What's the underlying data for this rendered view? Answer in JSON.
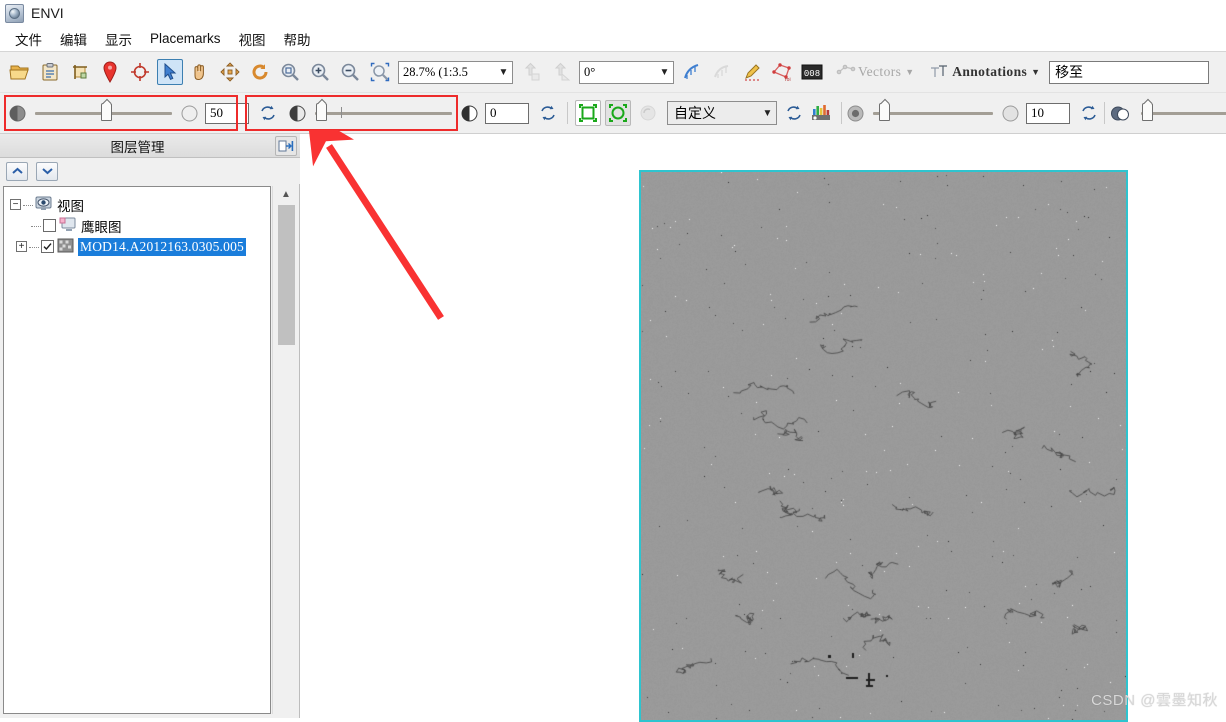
{
  "window": {
    "title": "ENVI",
    "icon": "envi-globe-icon"
  },
  "menubar": {
    "items": [
      {
        "label": "文件",
        "name": "menu-file"
      },
      {
        "label": "编辑",
        "name": "menu-edit"
      },
      {
        "label": "显示",
        "name": "menu-display"
      },
      {
        "label": "Placemarks",
        "name": "menu-placemarks"
      },
      {
        "label": "视图",
        "name": "menu-view"
      },
      {
        "label": "帮助",
        "name": "menu-help"
      }
    ]
  },
  "toolbar1": {
    "buttons": [
      {
        "name": "open-file-icon",
        "title": "打开"
      },
      {
        "name": "clipboard-icon",
        "title": "剪贴板"
      },
      {
        "name": "crop-icon",
        "title": "裁剪"
      },
      {
        "name": "placemark-pin-icon",
        "title": "标记"
      },
      {
        "name": "crosshair-icon",
        "title": "十字光标"
      },
      {
        "name": "select-cursor-icon",
        "title": "选择",
        "selected": true
      },
      {
        "name": "pan-hand-icon",
        "title": "平移"
      },
      {
        "name": "move-arrows-icon",
        "title": "移动"
      },
      {
        "name": "rotate-icon",
        "title": "旋转"
      },
      {
        "name": "zoom-fit-icon",
        "title": "缩放至窗口"
      },
      {
        "name": "zoom-in-icon",
        "title": "放大"
      },
      {
        "name": "zoom-out-icon",
        "title": "缩小"
      },
      {
        "name": "zoom-select-icon",
        "title": "区域缩放"
      }
    ],
    "zoom_combo": {
      "value": "28.7% (1:3.5",
      "name": "zoom-level-combo"
    },
    "up_layer": {
      "name": "go-up-layer-icon"
    },
    "up_layer2": {
      "name": "go-up-layer-alt-icon"
    },
    "rotation_combo": {
      "value": "0°",
      "name": "rotation-combo"
    },
    "after_buttons": [
      {
        "name": "measure-icon"
      },
      {
        "name": "measure-alt-icon",
        "disabled": true
      },
      {
        "name": "roi-pencil-icon"
      },
      {
        "name": "roi-tool-icon"
      },
      {
        "name": "pixel-value-icon"
      }
    ],
    "vectors": {
      "label": "Vectors",
      "name": "vectors-menu",
      "disabled": true
    },
    "annotations": {
      "label": "Annotations",
      "name": "annotations-menu"
    },
    "goto": {
      "value": "移至",
      "name": "goto-input"
    }
  },
  "toolbar2": {
    "transparency": {
      "value": "50",
      "name": "transparency-slider",
      "left_icon": "opacity-full-icon",
      "right_icon": "opacity-none-icon",
      "reset": "reset-transparency-icon",
      "thumb_pct": 52
    },
    "brightness": {
      "value": "0",
      "name": "brightness-slider",
      "left_icon": "brightness-icon",
      "right_icon": "brightness-alt-icon",
      "reset": "reset-brightness-icon",
      "thumb_pct": 1
    },
    "stretch_buttons": [
      {
        "name": "stretch-square-icon"
      },
      {
        "name": "stretch-circle-icon"
      }
    ],
    "stretch_refresh": {
      "name": "stretch-refresh-icon",
      "disabled": true
    },
    "stretch_combo": {
      "value": "自定义",
      "name": "stretch-type-combo"
    },
    "stretch_reset": {
      "name": "reset-stretch-icon"
    },
    "histogram": {
      "name": "histogram-icon"
    },
    "sharpen": {
      "value": "10",
      "name": "sharpen-slider",
      "left_icon": "sharpen-icon",
      "right_icon": "sharpen-level-icon",
      "reset": "reset-sharpen-icon",
      "thumb_pct": 7
    },
    "blend": {
      "value": "0",
      "name": "blend-slider",
      "left_icon": "blend-icon",
      "right_icon": "blend-level-icon",
      "reset": "reset-blend-icon",
      "thumb_pct": 1
    }
  },
  "layer_manager": {
    "title": "图层管理",
    "pin_icon": "pin-panel-icon",
    "move_up": {
      "name": "move-layer-up-button"
    },
    "move_down": {
      "name": "move-layer-down-button"
    },
    "tree": {
      "root": {
        "label": "视图",
        "expander": "−",
        "icon": "view-eye-icon"
      },
      "children": [
        {
          "label": "鹰眼图",
          "checked": false,
          "icon": "overview-monitor-icon",
          "expander": ""
        },
        {
          "label": "MOD14.A2012163.0305.005",
          "checked": true,
          "icon": "raster-layer-icon",
          "expander": "+",
          "selected": true
        }
      ]
    },
    "scrollbar": {
      "name": "layer-panel-scrollbar"
    }
  },
  "canvas": {
    "name": "image-view-canvas",
    "border_color": "#2ec4cf",
    "image_alt": "MODIS satellite grayscale scene"
  },
  "annotations": {
    "red_box_1": {
      "name": "annotation-red-box-transparency",
      "color": "#ee2b2b"
    },
    "red_box_2": {
      "name": "annotation-red-box-brightness",
      "color": "#ee2b2b"
    },
    "red_arrow": {
      "name": "annotation-red-arrow",
      "color": "#f93232"
    }
  },
  "watermark": {
    "text": "CSDN @雲墨知秋"
  }
}
